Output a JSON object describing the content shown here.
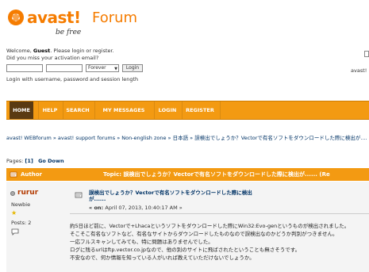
{
  "brand": {
    "name": "avast!",
    "section": "Forum",
    "tagline": "be free"
  },
  "login": {
    "welcome_prefix": "Welcome, ",
    "guest": "Guest",
    "welcome_suffix": ". Please login or register.",
    "activation": "Did you miss your activation email?",
    "duration_option": "Forever",
    "login_button": "Login",
    "note": "Login with username, password and session length"
  },
  "right_fragment": "avast! Fo",
  "nav": {
    "items": [
      "HOME",
      "HELP",
      "SEARCH",
      "MY MESSAGES",
      "LOGIN",
      "REGISTER"
    ]
  },
  "breadcrumb": "avast! WEBforum » avast! support forums » Non-english zone » 日本語 » 誤検出でしょうか？Vectorで有名ソフトをダウンロードした際に検出が....",
  "pages": {
    "label": "Pages: ",
    "current": "[1]",
    "go_down": "Go Down"
  },
  "topic_header": {
    "author_label": "Author",
    "topic_label": "Topic: 誤検出でしょうか？Vectorで有名ソフトをダウンロードした際に検出が......  (Re"
  },
  "post": {
    "username": "rurur",
    "rank": "Newbie",
    "posts_label": "Posts: 2",
    "title_line1": "誤検出でしょうか？Vectorで有名ソフトをダウンロードした際に検出",
    "title_line2": "が......",
    "date_prefix": "« on: ",
    "date": "April 07, 2013, 10:40:17 AM »",
    "body": [
      "約5日ほど前に、Vectorで+Lhacaというソフトをダウンロードした際にWin32:Evo-genというものが検出されました。",
      "そこそこ有名なソフトなど、有名なサイトからダウンロードしたものなので誤検出なのかどうか判別がつきません。",
      "一応フルスキャンしてみても、特に問題はありませんでした。",
      "ログに残るurlはftp.vector.co.jpなので、他の別のサイトに飛ばされたということも無さそうです。",
      "不安なので、何か情報を知っている人がいれば教えていただけないでしょうか。"
    ]
  },
  "colors": {
    "accent": "#f39a12",
    "brand": "#f57c00",
    "home_tab": "#5a3a12",
    "username": "#b33a00"
  }
}
